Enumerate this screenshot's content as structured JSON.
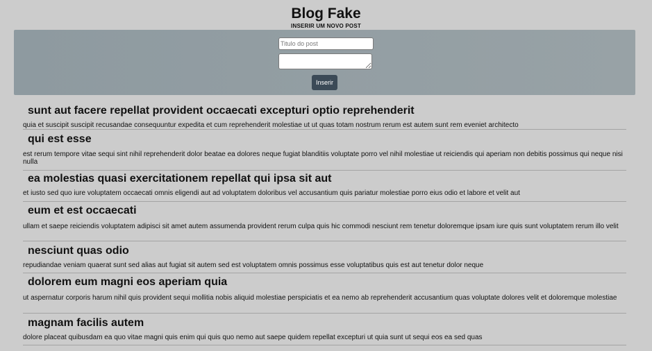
{
  "header": {
    "title": "Blog Fake"
  },
  "form": {
    "subtitle": "INSERIR UM NOVO POST",
    "title_placeholder": "Titulo do post",
    "title_value": "",
    "body_value": "",
    "submit_label": "Inserir",
    "panel_color": "#939ea3",
    "button_color": "#3b4a57"
  },
  "posts": [
    {
      "title": "sunt aut facere repellat provident occaecati excepturi optio reprehenderit",
      "body": "quia et suscipit suscipit recusandae consequuntur expedita et cum reprehenderit molestiae ut ut quas totam nostrum rerum est autem sunt rem eveniet architecto"
    },
    {
      "title": "qui est esse",
      "body": "est rerum tempore vitae sequi sint nihil reprehenderit dolor beatae ea dolores neque fugiat blanditiis voluptate porro vel nihil molestiae ut reiciendis qui aperiam non debitis possimus qui neque nisi nulla"
    },
    {
      "title": "ea molestias quasi exercitationem repellat qui ipsa sit aut",
      "body": "et iusto sed quo iure voluptatem occaecati omnis eligendi aut ad voluptatem doloribus vel accusantium quis pariatur molestiae porro eius odio et labore et velit aut"
    },
    {
      "title": "eum et est occaecati",
      "body": "ullam et saepe reiciendis voluptatem adipisci sit amet autem assumenda provident rerum culpa quis hic commodi nesciunt rem tenetur doloremque ipsam iure quis sunt voluptatem rerum illo velit"
    },
    {
      "title": "nesciunt quas odio",
      "body": "repudiandae veniam quaerat sunt sed alias aut fugiat sit autem sed est voluptatem omnis possimus esse voluptatibus quis est aut tenetur dolor neque"
    },
    {
      "title": "dolorem eum magni eos aperiam quia",
      "body": "ut aspernatur corporis harum nihil quis provident sequi mollitia nobis aliquid molestiae perspiciatis et ea nemo ab reprehenderit accusantium quas voluptate dolores velit et doloremque molestiae"
    },
    {
      "title": "magnam facilis autem",
      "body": "dolore placeat quibusdam ea quo vitae magni quis enim qui quis quo nemo aut saepe quidem repellat excepturi ut quia sunt ut sequi eos ea sed quas"
    }
  ]
}
